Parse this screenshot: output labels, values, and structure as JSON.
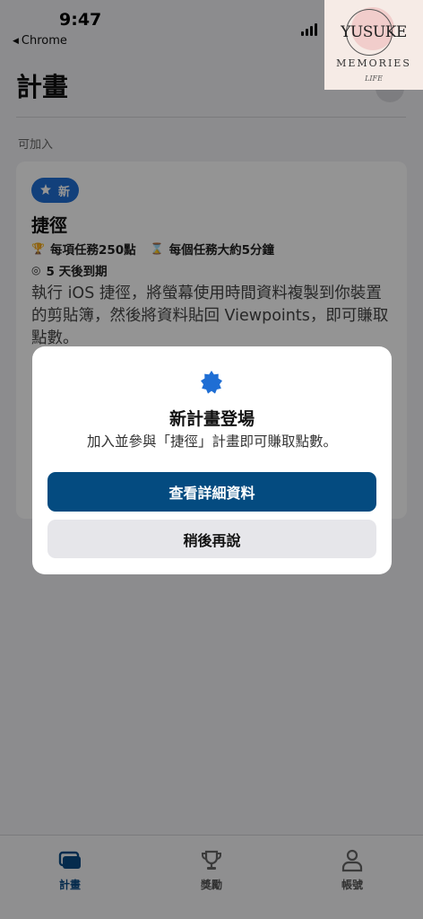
{
  "status_bar": {
    "time": "9:47",
    "back_app": "Chrome"
  },
  "header": {
    "title": "計畫"
  },
  "section": {
    "label": "可加入"
  },
  "program_card": {
    "badge": "新",
    "title": "捷徑",
    "reward": "每項任務250點",
    "duration": "每個任務大約5分鐘",
    "expires": "5 天後到期",
    "description": "執行 iOS 捷徑，將螢幕使用時間資料複製到你裝置的剪貼簿，然後將資料貼回 Viewpoints，即可賺取點數。"
  },
  "modal": {
    "icon": "star-badge-icon",
    "title": "新計畫登場",
    "subtitle": "加入並參與「捷徑」計畫即可賺取點數。",
    "primary_button": "查看詳細資料",
    "secondary_button": "稍後再說"
  },
  "tab_bar": {
    "tabs": [
      {
        "label": "計畫",
        "icon": "programs-icon",
        "active": true
      },
      {
        "label": "獎勵",
        "icon": "trophy-icon",
        "active": false
      },
      {
        "label": "帳號",
        "icon": "person-icon",
        "active": false
      }
    ]
  },
  "watermark": {
    "line1": "YUSUKE",
    "line2": "MEMORIES",
    "line3": "LIFE"
  },
  "colors": {
    "accent": "#044b80",
    "badge": "#1f6ed4",
    "modal_icon": "#1f6ed4"
  }
}
